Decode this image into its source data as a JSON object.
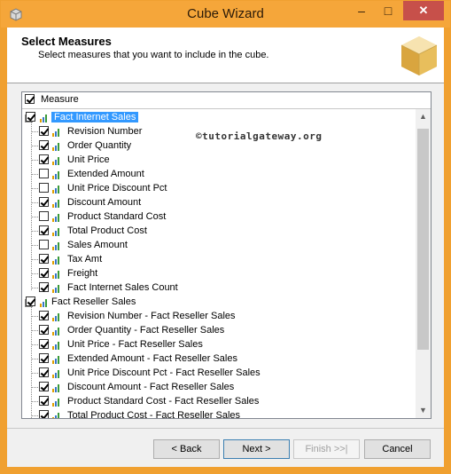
{
  "window": {
    "title": "Cube Wizard",
    "minimize": "–",
    "maximize": "□",
    "close": "✕"
  },
  "header": {
    "title": "Select Measures",
    "subtitle": "Select measures that you want to include in the cube."
  },
  "watermark": "©tutorialgateway.org",
  "tree": {
    "root_label": "Measure",
    "groups": [
      {
        "label": "Fact Internet Sales",
        "checked": true,
        "items": [
          {
            "label": "Revision Number",
            "checked": true
          },
          {
            "label": "Order Quantity",
            "checked": true
          },
          {
            "label": "Unit Price",
            "checked": true
          },
          {
            "label": "Extended Amount",
            "checked": false
          },
          {
            "label": "Unit Price Discount Pct",
            "checked": false
          },
          {
            "label": "Discount Amount",
            "checked": true
          },
          {
            "label": "Product Standard Cost",
            "checked": false
          },
          {
            "label": "Total Product Cost",
            "checked": true
          },
          {
            "label": "Sales Amount",
            "checked": false
          },
          {
            "label": "Tax Amt",
            "checked": true
          },
          {
            "label": "Freight",
            "checked": true
          },
          {
            "label": "Fact Internet Sales Count",
            "checked": true
          }
        ]
      },
      {
        "label": "Fact Reseller Sales",
        "checked": true,
        "items": [
          {
            "label": "Revision Number - Fact Reseller Sales",
            "checked": true
          },
          {
            "label": "Order Quantity - Fact Reseller Sales",
            "checked": true
          },
          {
            "label": "Unit Price - Fact Reseller Sales",
            "checked": true
          },
          {
            "label": "Extended Amount - Fact Reseller Sales",
            "checked": true
          },
          {
            "label": "Unit Price Discount Pct - Fact Reseller Sales",
            "checked": true
          },
          {
            "label": "Discount Amount - Fact Reseller Sales",
            "checked": true
          },
          {
            "label": "Product Standard Cost - Fact Reseller Sales",
            "checked": true
          },
          {
            "label": "Total Product Cost - Fact Reseller Sales",
            "checked": true
          }
        ]
      }
    ]
  },
  "buttons": {
    "back": "< Back",
    "next": "Next >",
    "finish": "Finish >>|",
    "cancel": "Cancel"
  },
  "colors": {
    "titlebar": "#f5a63a",
    "selection": "#3399ff",
    "close": "#c7504a"
  }
}
